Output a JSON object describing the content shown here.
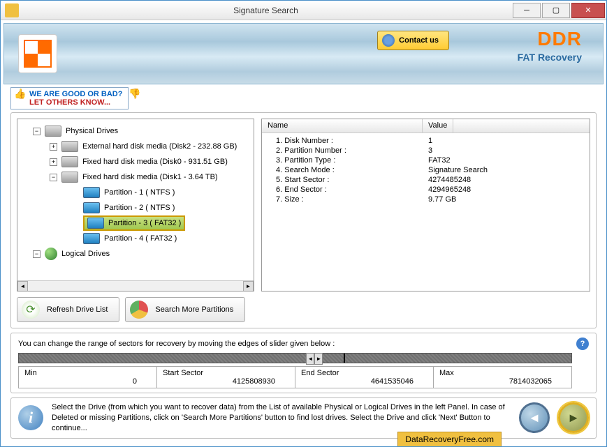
{
  "window": {
    "title": "Signature Search"
  },
  "header": {
    "contact_label": "Contact us",
    "brand": "DDR",
    "brand_sub": "FAT Recovery"
  },
  "review": {
    "line1": "WE ARE GOOD OR BAD?",
    "line2": "LET OTHERS KNOW..."
  },
  "tree": {
    "physical": "Physical Drives",
    "ext": "External hard disk media (Disk2 - 232.88 GB)",
    "fixed0": "Fixed hard disk media (Disk0 - 931.51 GB)",
    "fixed1": "Fixed hard disk media (Disk1 - 3.64 TB)",
    "p1": "Partition - 1 ( NTFS )",
    "p2": "Partition - 2 ( NTFS )",
    "p3": "Partition - 3 ( FAT32 )",
    "p4": "Partition - 4 ( FAT32 )",
    "logical": "Logical Drives"
  },
  "detail": {
    "head_name": "Name",
    "head_value": "Value",
    "rows": [
      {
        "n": "1. Disk Number :",
        "v": "1"
      },
      {
        "n": "2. Partition Number :",
        "v": "3"
      },
      {
        "n": "3. Partition Type :",
        "v": "FAT32"
      },
      {
        "n": "4. Search Mode :",
        "v": "Signature Search"
      },
      {
        "n": "5. Start Sector :",
        "v": "4274485248"
      },
      {
        "n": "6. End Sector :",
        "v": "4294965248"
      },
      {
        "n": "7. Size :",
        "v": "9.77 GB"
      }
    ]
  },
  "buttons": {
    "refresh": "Refresh Drive List",
    "search_more": "Search More Partitions"
  },
  "sector": {
    "label": "You can change the range of sectors for recovery by moving the edges of slider given below :",
    "min_lbl": "Min",
    "min_val": "0",
    "start_lbl": "Start Sector",
    "start_val": "4125808930",
    "end_lbl": "End Sector",
    "end_val": "4641535046",
    "max_lbl": "Max",
    "max_val": "7814032065"
  },
  "hint": "Select the Drive (from which you want to recover data) from the List of available Physical or Logical Drives in the left Panel. In case of Deleted or missing Partitions, click on 'Search More Partitions' button to find lost drives. Select the Drive and click 'Next' Button to continue...",
  "footer": {
    "link": "DataRecoveryFree.com"
  }
}
